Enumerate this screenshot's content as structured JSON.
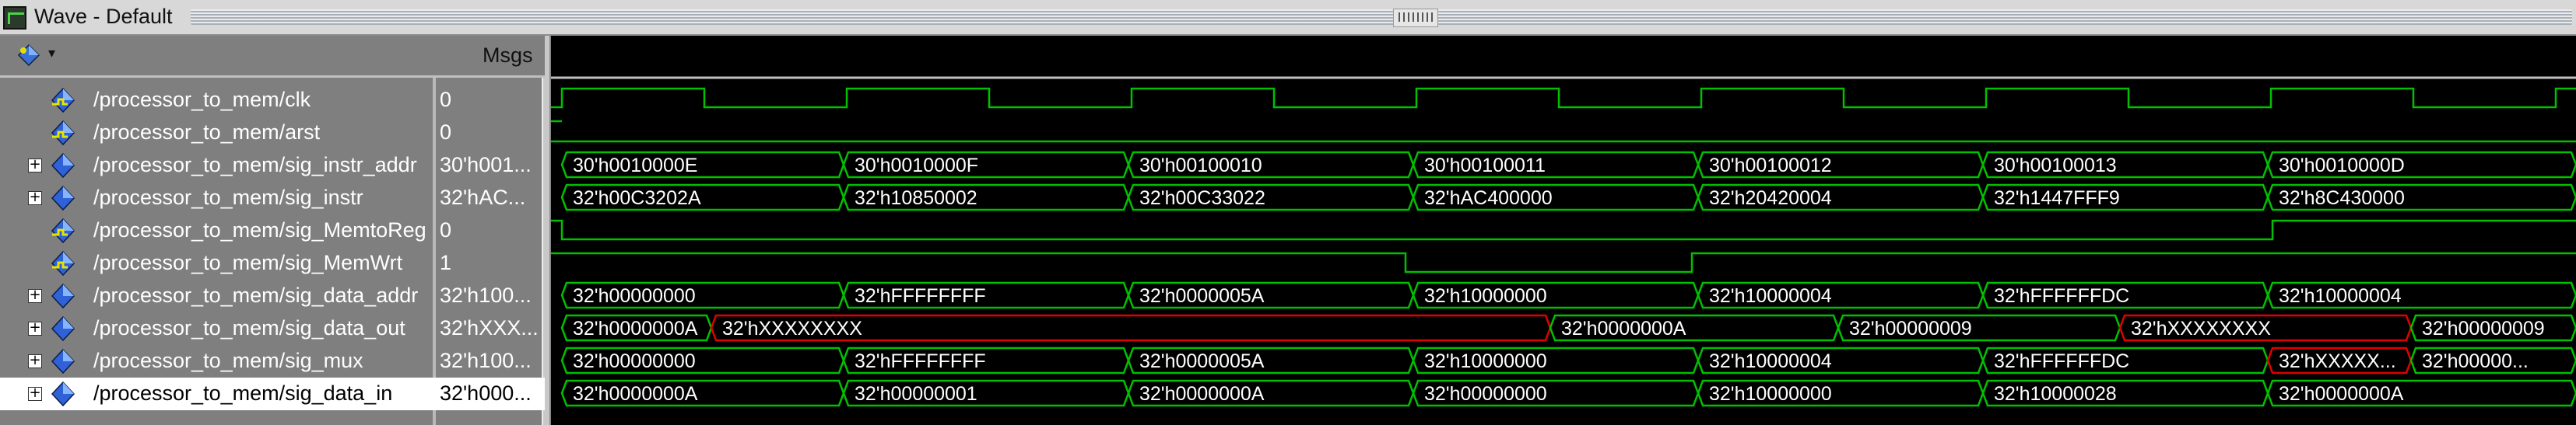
{
  "window": {
    "title": "Wave - Default"
  },
  "header": {
    "msgs_label": "Msgs"
  },
  "colors": {
    "wave": "#00c000",
    "error": "#e00000",
    "background": "#000000"
  },
  "signals": [
    {
      "name": "/processor_to_mem/clk",
      "value": "0",
      "type": "bit",
      "expandable": false
    },
    {
      "name": "/processor_to_mem/arst",
      "value": "0",
      "type": "bit",
      "expandable": false
    },
    {
      "name": "/processor_to_mem/sig_instr_addr",
      "value": "30'h001...",
      "type": "bus",
      "expandable": true,
      "segments": [
        "30'h0010000E",
        "30'h0010000F",
        "30'h00100010",
        "30'h00100011",
        "30'h00100012",
        "30'h00100013",
        "30'h0010000D"
      ]
    },
    {
      "name": "/processor_to_mem/sig_instr",
      "value": "32'hAC...",
      "type": "bus",
      "expandable": true,
      "segments": [
        "32'h00C3202A",
        "32'h10850002",
        "32'h00C33022",
        "32'hAC400000",
        "32'h20420004",
        "32'h1447FFF9",
        "32'h8C430000"
      ]
    },
    {
      "name": "/processor_to_mem/sig_MemtoReg",
      "value": "0",
      "type": "bit",
      "expandable": false
    },
    {
      "name": "/processor_to_mem/sig_MemWrt",
      "value": "1",
      "type": "bit",
      "expandable": false
    },
    {
      "name": "/processor_to_mem/sig_data_addr",
      "value": "32'h100...",
      "type": "bus",
      "expandable": true,
      "segments": [
        "32'h00000000",
        "32'hFFFFFFFF",
        "32'h0000005A",
        "32'h10000000",
        "32'h10000004",
        "32'hFFFFFFDC",
        "32'h10000004"
      ]
    },
    {
      "name": "/processor_to_mem/sig_data_out",
      "value": "32'hXXX...",
      "type": "bus",
      "expandable": true,
      "segments": [
        "32'h0000000A",
        "32'hXXXXXXXX",
        "32'h0000000A",
        "32'h00000009",
        "32'hXXXXXXXX",
        "32'h00000009"
      ]
    },
    {
      "name": "/processor_to_mem/sig_mux",
      "value": "32'h100...",
      "type": "bus",
      "expandable": true,
      "segments": [
        "32'h00000000",
        "32'hFFFFFFFF",
        "32'h0000005A",
        "32'h10000000",
        "32'h10000004",
        "32'hFFFFFFDC",
        "32'hXXXXX...",
        "32'h00000..."
      ]
    },
    {
      "name": "/processor_to_mem/sig_data_in",
      "value": "32'h000...",
      "type": "bus",
      "expandable": true,
      "selected": true,
      "segments": [
        "32'h0000000A",
        "32'h00000001",
        "32'h0000000A",
        "32'h00000000",
        "32'h10000000",
        "32'h10000028",
        "32'h0000000A"
      ]
    }
  ]
}
